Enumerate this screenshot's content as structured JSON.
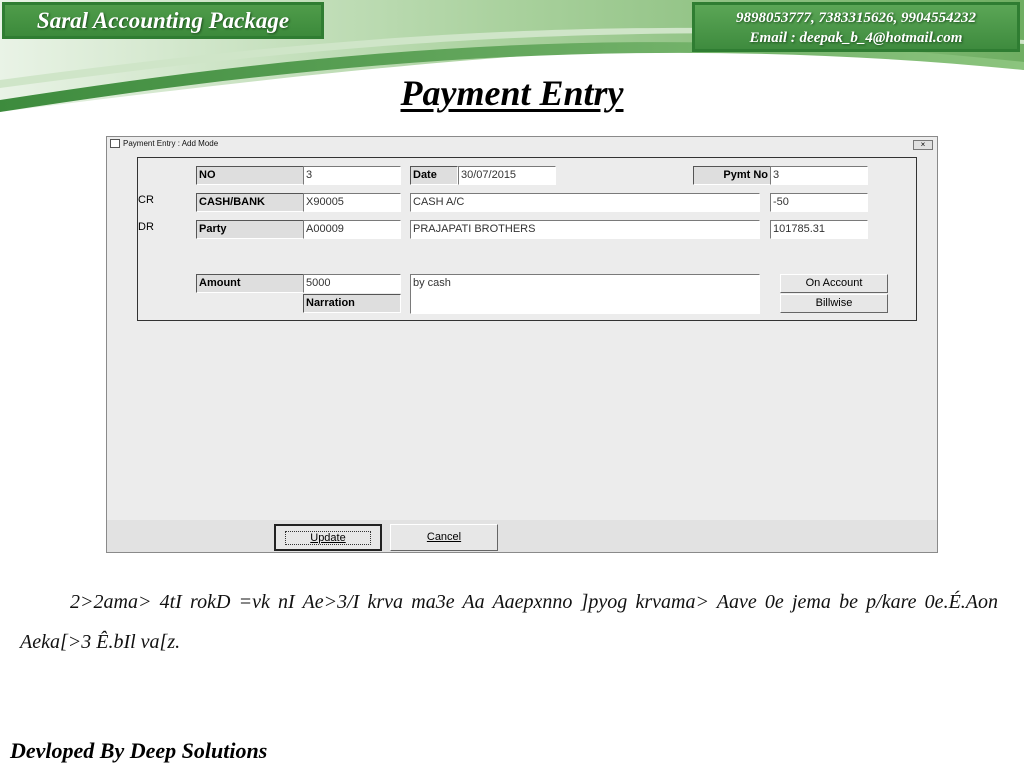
{
  "header": {
    "brand": "Saral Accounting Package",
    "contact_phones": "9898053777, 7383315626, 9904554232",
    "contact_email": "Email : deepak_b_4@hotmail.com",
    "accent_color": "#3c8a3b"
  },
  "page_title": "Payment Entry",
  "window": {
    "title": "Payment Entry : Add Mode",
    "close_icon": "close-icon",
    "form": {
      "no_label": "NO",
      "no_value": "3",
      "date_label": "Date",
      "date_value": "30/07/2015",
      "pymt_no_label": "Pymt No",
      "pymt_no_value": "3",
      "cr_label": "CR",
      "cash_bank_label": "CASH/BANK",
      "cash_bank_code": "X90005",
      "cash_bank_name": "CASH A/C",
      "cash_bank_balance": "-50",
      "dr_label": "DR",
      "party_label": "Party",
      "party_code": "A00009",
      "party_name": "PRAJAPATI BROTHERS",
      "party_balance": "101785.31",
      "amount_label": "Amount",
      "amount_value": "5000",
      "narration_label": "Narration",
      "narration_value": "by cash",
      "on_account_button": "On Account",
      "billwise_button": "Billwise"
    },
    "update_button": "Update",
    "cancel_button": "Cancel"
  },
  "body_text": "2>2ama> 4tI rokD =vk nI Ae>3/I krva ma3e Aa Aaepxnno ]pyog krvama> Aave 0e jema be p/kare 0e.É.Aon Aeka[>3 Ê.bIl va[z.",
  "footer": "Devloped By Deep Solutions"
}
